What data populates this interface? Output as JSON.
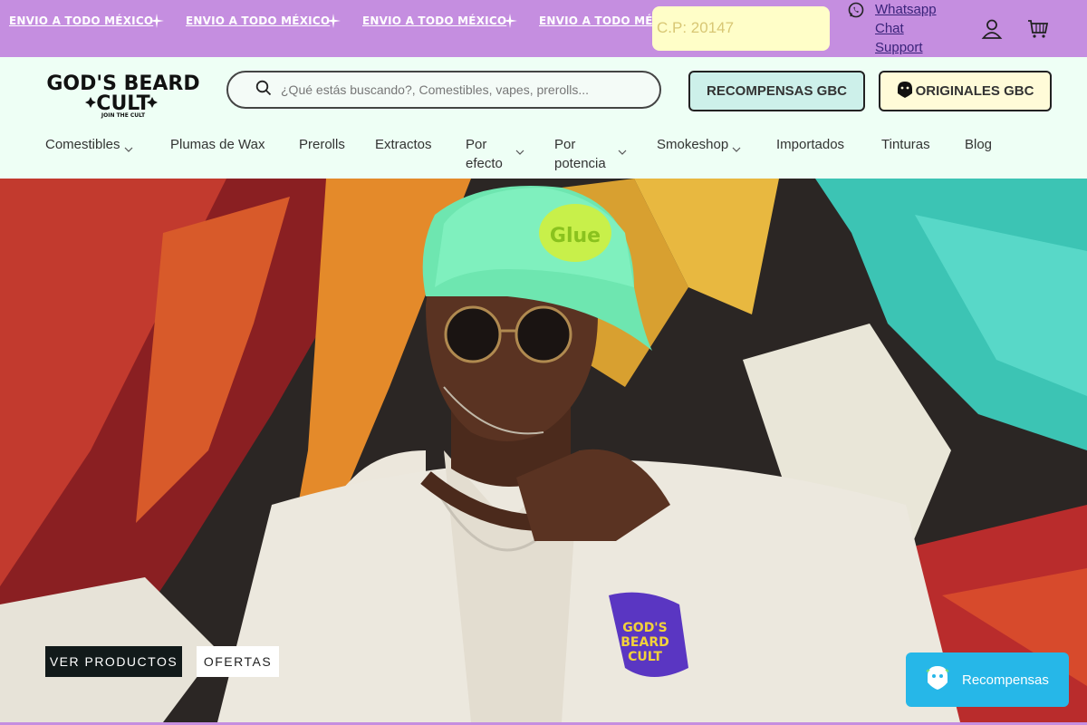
{
  "announcement": {
    "items": [
      "ENVIO A TODO MÉXICO",
      "ENVIO A TODO MÉXICO",
      "ENVIO A TODO MÉXICO",
      "ENVIO A TODO MÉXIC"
    ],
    "postal_code": "C.P: 20147",
    "whatsapp_label": "Whatsapp Chat Support",
    "icons": [
      "sparkle-icon",
      "whatsapp-icon",
      "user-icon",
      "cart-icon"
    ]
  },
  "header": {
    "logo_text": "GOD'S BEARD CULT",
    "logo_tagline": "JOIN THE CULT",
    "search_placeholder": "¿Qué estás buscando?, Comestibles, vapes, prerolls...",
    "rewards_button": "RECOMPENSAS GBC",
    "originals_button": "ORIGINALES GBC"
  },
  "nav": {
    "items": [
      {
        "label": "Comestibles",
        "dropdown": true
      },
      {
        "label": "Plumas de Wax",
        "dropdown": false
      },
      {
        "label": "Prerolls",
        "dropdown": false
      },
      {
        "label": "Extractos",
        "dropdown": false
      },
      {
        "label": "Por efecto",
        "dropdown": true
      },
      {
        "label": "Por potencia",
        "dropdown": true
      },
      {
        "label": "Smokeshop",
        "dropdown": true
      },
      {
        "label": "Importados",
        "dropdown": false
      },
      {
        "label": "Tinturas",
        "dropdown": false
      },
      {
        "label": "Blog",
        "dropdown": false
      }
    ]
  },
  "hero": {
    "cta_primary": "VER PRODUCTOS",
    "cta_secondary": "OFERTAS"
  },
  "widget": {
    "label": "Recompensas"
  },
  "colors": {
    "topbar": "#c58ee0",
    "header_bg": "#eefff5",
    "postal_bg": "#fffec8",
    "rewards_btn_bg": "#cdf0ea",
    "originals_btn_bg": "#fffbd8",
    "widget_bg": "#26b7e8"
  }
}
